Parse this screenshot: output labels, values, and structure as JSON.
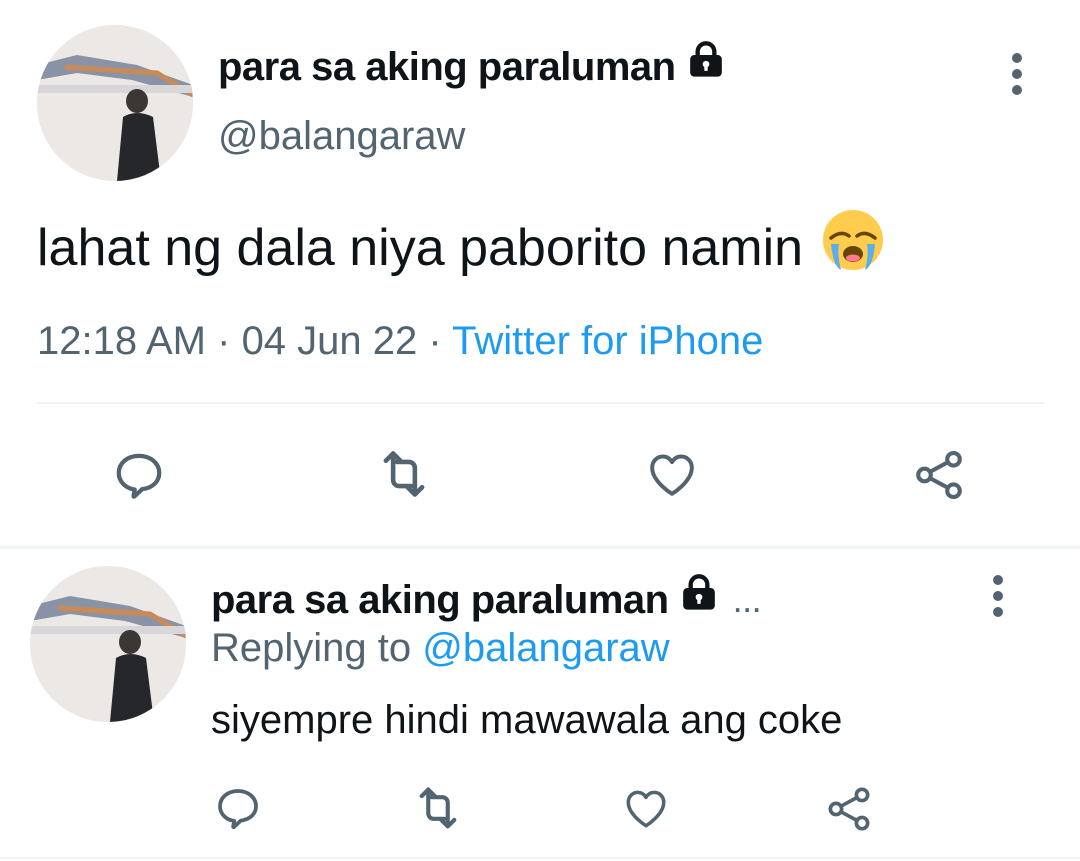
{
  "main_tweet": {
    "display_name": "para sa aking paraluman",
    "handle": "@balangaraw",
    "text": "lahat ng dala niya paborito namin",
    "emoji": "😭",
    "time": "12:18 AM",
    "sep1": " · ",
    "date": "04 Jun 22",
    "sep2": " · ",
    "source": "Twitter for iPhone"
  },
  "reply_tweet": {
    "display_name": "para sa aking paraluman",
    "ellipsis": "...",
    "replying_prefix": "Replying to ",
    "replying_to": "@balangaraw",
    "text": "siyempre hindi mawawala ang coke"
  },
  "icons": {
    "lock": "lock-icon",
    "more": "more-vertical-icon",
    "reply": "reply-icon",
    "retweet": "retweet-icon",
    "like": "heart-icon",
    "share": "share-icon"
  },
  "colors": {
    "primary_text": "#0f1419",
    "secondary_text": "#536471",
    "accent": "#1d9bf0",
    "divider": "#eff3f4"
  }
}
